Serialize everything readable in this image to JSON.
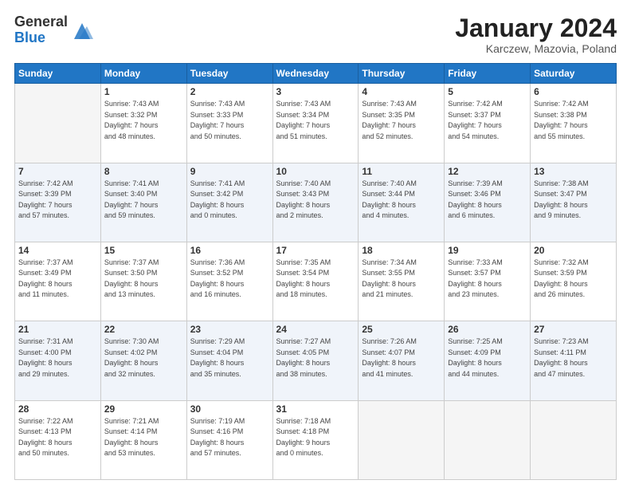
{
  "header": {
    "logo": {
      "general": "General",
      "blue": "Blue"
    },
    "title": "January 2024",
    "subtitle": "Karczew, Mazovia, Poland"
  },
  "days_of_week": [
    "Sunday",
    "Monday",
    "Tuesday",
    "Wednesday",
    "Thursday",
    "Friday",
    "Saturday"
  ],
  "weeks": [
    [
      {
        "num": "",
        "info": ""
      },
      {
        "num": "1",
        "info": "Sunrise: 7:43 AM\nSunset: 3:32 PM\nDaylight: 7 hours\nand 48 minutes."
      },
      {
        "num": "2",
        "info": "Sunrise: 7:43 AM\nSunset: 3:33 PM\nDaylight: 7 hours\nand 50 minutes."
      },
      {
        "num": "3",
        "info": "Sunrise: 7:43 AM\nSunset: 3:34 PM\nDaylight: 7 hours\nand 51 minutes."
      },
      {
        "num": "4",
        "info": "Sunrise: 7:43 AM\nSunset: 3:35 PM\nDaylight: 7 hours\nand 52 minutes."
      },
      {
        "num": "5",
        "info": "Sunrise: 7:42 AM\nSunset: 3:37 PM\nDaylight: 7 hours\nand 54 minutes."
      },
      {
        "num": "6",
        "info": "Sunrise: 7:42 AM\nSunset: 3:38 PM\nDaylight: 7 hours\nand 55 minutes."
      }
    ],
    [
      {
        "num": "7",
        "info": "Sunrise: 7:42 AM\nSunset: 3:39 PM\nDaylight: 7 hours\nand 57 minutes."
      },
      {
        "num": "8",
        "info": "Sunrise: 7:41 AM\nSunset: 3:40 PM\nDaylight: 7 hours\nand 59 minutes."
      },
      {
        "num": "9",
        "info": "Sunrise: 7:41 AM\nSunset: 3:42 PM\nDaylight: 8 hours\nand 0 minutes."
      },
      {
        "num": "10",
        "info": "Sunrise: 7:40 AM\nSunset: 3:43 PM\nDaylight: 8 hours\nand 2 minutes."
      },
      {
        "num": "11",
        "info": "Sunrise: 7:40 AM\nSunset: 3:44 PM\nDaylight: 8 hours\nand 4 minutes."
      },
      {
        "num": "12",
        "info": "Sunrise: 7:39 AM\nSunset: 3:46 PM\nDaylight: 8 hours\nand 6 minutes."
      },
      {
        "num": "13",
        "info": "Sunrise: 7:38 AM\nSunset: 3:47 PM\nDaylight: 8 hours\nand 9 minutes."
      }
    ],
    [
      {
        "num": "14",
        "info": "Sunrise: 7:37 AM\nSunset: 3:49 PM\nDaylight: 8 hours\nand 11 minutes."
      },
      {
        "num": "15",
        "info": "Sunrise: 7:37 AM\nSunset: 3:50 PM\nDaylight: 8 hours\nand 13 minutes."
      },
      {
        "num": "16",
        "info": "Sunrise: 7:36 AM\nSunset: 3:52 PM\nDaylight: 8 hours\nand 16 minutes."
      },
      {
        "num": "17",
        "info": "Sunrise: 7:35 AM\nSunset: 3:54 PM\nDaylight: 8 hours\nand 18 minutes."
      },
      {
        "num": "18",
        "info": "Sunrise: 7:34 AM\nSunset: 3:55 PM\nDaylight: 8 hours\nand 21 minutes."
      },
      {
        "num": "19",
        "info": "Sunrise: 7:33 AM\nSunset: 3:57 PM\nDaylight: 8 hours\nand 23 minutes."
      },
      {
        "num": "20",
        "info": "Sunrise: 7:32 AM\nSunset: 3:59 PM\nDaylight: 8 hours\nand 26 minutes."
      }
    ],
    [
      {
        "num": "21",
        "info": "Sunrise: 7:31 AM\nSunset: 4:00 PM\nDaylight: 8 hours\nand 29 minutes."
      },
      {
        "num": "22",
        "info": "Sunrise: 7:30 AM\nSunset: 4:02 PM\nDaylight: 8 hours\nand 32 minutes."
      },
      {
        "num": "23",
        "info": "Sunrise: 7:29 AM\nSunset: 4:04 PM\nDaylight: 8 hours\nand 35 minutes."
      },
      {
        "num": "24",
        "info": "Sunrise: 7:27 AM\nSunset: 4:05 PM\nDaylight: 8 hours\nand 38 minutes."
      },
      {
        "num": "25",
        "info": "Sunrise: 7:26 AM\nSunset: 4:07 PM\nDaylight: 8 hours\nand 41 minutes."
      },
      {
        "num": "26",
        "info": "Sunrise: 7:25 AM\nSunset: 4:09 PM\nDaylight: 8 hours\nand 44 minutes."
      },
      {
        "num": "27",
        "info": "Sunrise: 7:23 AM\nSunset: 4:11 PM\nDaylight: 8 hours\nand 47 minutes."
      }
    ],
    [
      {
        "num": "28",
        "info": "Sunrise: 7:22 AM\nSunset: 4:13 PM\nDaylight: 8 hours\nand 50 minutes."
      },
      {
        "num": "29",
        "info": "Sunrise: 7:21 AM\nSunset: 4:14 PM\nDaylight: 8 hours\nand 53 minutes."
      },
      {
        "num": "30",
        "info": "Sunrise: 7:19 AM\nSunset: 4:16 PM\nDaylight: 8 hours\nand 57 minutes."
      },
      {
        "num": "31",
        "info": "Sunrise: 7:18 AM\nSunset: 4:18 PM\nDaylight: 9 hours\nand 0 minutes."
      },
      {
        "num": "",
        "info": ""
      },
      {
        "num": "",
        "info": ""
      },
      {
        "num": "",
        "info": ""
      }
    ]
  ]
}
